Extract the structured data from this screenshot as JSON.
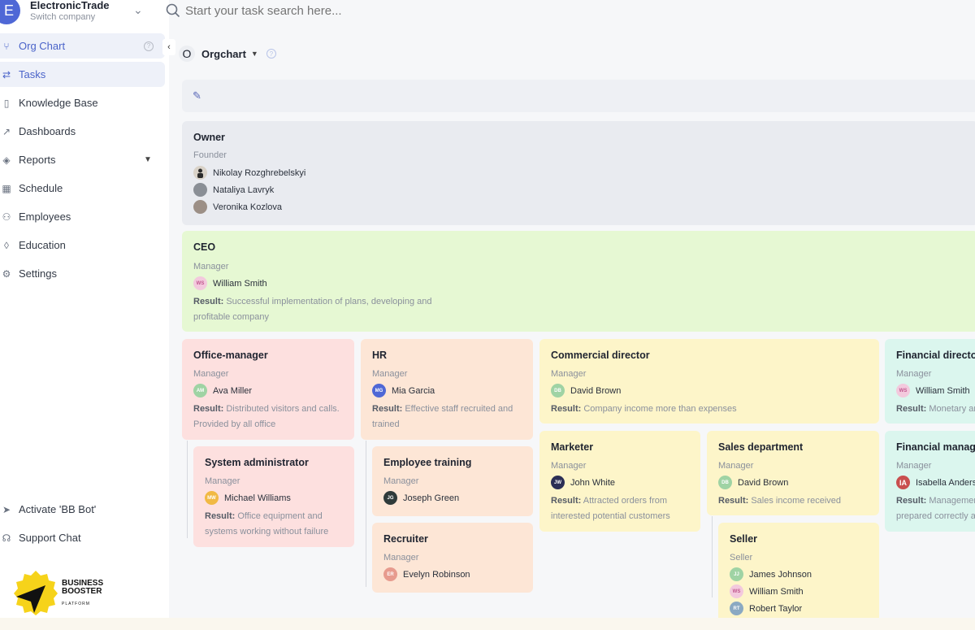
{
  "company": {
    "initial": "E",
    "name": "ElectronicTrade",
    "sub": "Switch company"
  },
  "search": {
    "placeholder": "Start your task search here..."
  },
  "sidebar": {
    "items": [
      {
        "label": "Org Chart"
      },
      {
        "label": "Tasks"
      },
      {
        "label": "Knowledge Base"
      },
      {
        "label": "Dashboards"
      },
      {
        "label": "Reports"
      },
      {
        "label": "Schedule"
      },
      {
        "label": "Employees"
      },
      {
        "label": "Education"
      },
      {
        "label": "Settings"
      }
    ],
    "bottom": [
      {
        "label": "Activate 'BB Bot'"
      },
      {
        "label": "Support Chat"
      }
    ]
  },
  "logo": {
    "line1": "BUSINESS",
    "line2": "BOOSTER",
    "line3": "PLATFORM"
  },
  "main": {
    "initial": "O",
    "title": "Orgchart"
  },
  "colors": {
    "accent": "#4a63c9",
    "owner": "#e9ebf0",
    "ceo": "#e6f8d3",
    "pink": "#fde0df",
    "orange": "#fde6d6",
    "yellow": "#fdf5c9",
    "teal": "#dbf6ee"
  },
  "owner": {
    "title": "Owner",
    "role": "Founder",
    "people": [
      "Nikolay Rozghrebelskyi",
      "Nataliya Lavryk",
      "Veronika Kozlova"
    ]
  },
  "ceo": {
    "title": "CEO",
    "role": "Manager",
    "person": {
      "initials": "WS",
      "name": "William Smith"
    },
    "result_label": "Result:",
    "result_line1": "Successful implementation of plans, developing and",
    "result_line2": "profitable company"
  },
  "cards": {
    "office": {
      "title": "Office-manager",
      "role": "Manager",
      "initials": "AM",
      "name": "Ava Miller",
      "result_label": "Result:",
      "r1": "Distributed visitors and calls.",
      "r2": "Provided by all office"
    },
    "sysadmin": {
      "title": "System administrator",
      "role": "Manager",
      "initials": "MW",
      "name": "Michael Williams",
      "result_label": "Result:",
      "r1": "Office equipment and",
      "r2": "systems working without failure"
    },
    "hr": {
      "title": "HR",
      "role": "Manager",
      "initials": "MG",
      "name": "Mia Garcia",
      "result_label": "Result:",
      "r1": "Effective staff recruited and",
      "r2": "trained"
    },
    "training": {
      "title": "Employee training",
      "role": "Manager",
      "initials": "JG",
      "name": "Joseph Green"
    },
    "recruiter": {
      "title": "Recruiter",
      "role": "Manager",
      "initials": "ER",
      "name": "Evelyn Robinson"
    },
    "commercial": {
      "title": "Commercial director",
      "role": "Manager",
      "initials": "DB",
      "name": "David Brown",
      "result_label": "Result:",
      "r1": "Company income more than expenses"
    },
    "marketer": {
      "title": "Marketer",
      "role": "Manager",
      "initials": "JW",
      "name": "John White",
      "result_label": "Result:",
      "r1": "Attracted orders from",
      "r2": "interested potential customers"
    },
    "sales": {
      "title": "Sales department",
      "role": "Manager",
      "initials": "DB",
      "name": "David Brown",
      "result_label": "Result:",
      "r1": "Sales income received"
    },
    "seller": {
      "title": "Seller",
      "role": "Seller",
      "people": [
        {
          "initials": "JJ",
          "name": "James Johnson"
        },
        {
          "initials": "WS",
          "name": "William Smith"
        },
        {
          "initials": "RT",
          "name": "Robert Taylor"
        }
      ]
    },
    "findir": {
      "title": "Financial director",
      "role": "Manager",
      "initials": "WS",
      "name": "William Smith",
      "result_label": "Result:",
      "r1": "Monetary and"
    },
    "finman": {
      "title": "Financial manager",
      "role": "Manager",
      "initials": "IA",
      "name": "Isabella Anderson",
      "result_label": "Result:",
      "r1": "Management",
      "r2": "prepared correctly and"
    }
  }
}
